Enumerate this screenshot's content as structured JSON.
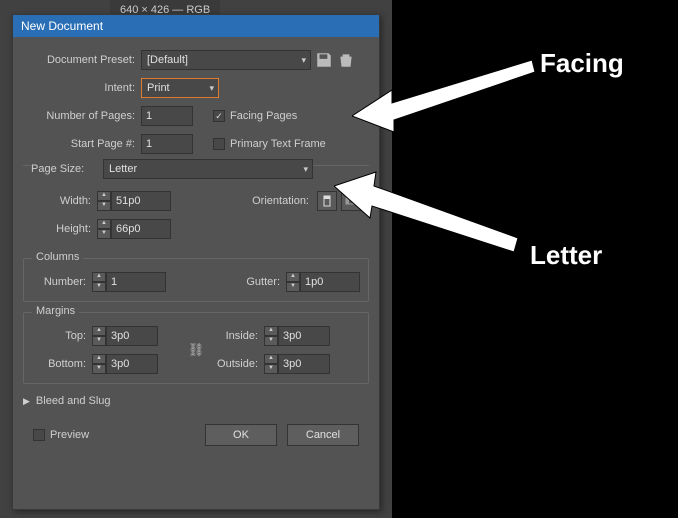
{
  "tab_scrap": "640 × 426 — RGB",
  "dialog": {
    "title": "New Document",
    "doc_preset_label": "Document Preset:",
    "doc_preset_value": "[Default]",
    "intent_label": "Intent:",
    "intent_value": "Print",
    "num_pages_label": "Number of Pages:",
    "num_pages_value": "1",
    "facing_pages_label": "Facing Pages",
    "facing_pages_checked": "✓",
    "start_page_label": "Start Page #:",
    "start_page_value": "1",
    "primary_tf_label": "Primary Text Frame",
    "page_size_label": "Page Size:",
    "page_size_value": "Letter",
    "width_label": "Width:",
    "width_value": "51p0",
    "height_label": "Height:",
    "height_value": "66p0",
    "orientation_label": "Orientation:",
    "columns_legend": "Columns",
    "col_number_label": "Number:",
    "col_number_value": "1",
    "gutter_label": "Gutter:",
    "gutter_value": "1p0",
    "margins_legend": "Margins",
    "m_top_label": "Top:",
    "m_top_value": "3p0",
    "m_bottom_label": "Bottom:",
    "m_bottom_value": "3p0",
    "m_inside_label": "Inside:",
    "m_inside_value": "3p0",
    "m_outside_label": "Outside:",
    "m_outside_value": "3p0",
    "bleed_slug_label": "Bleed and Slug",
    "preview_label": "Preview",
    "ok_label": "OK",
    "cancel_label": "Cancel"
  },
  "annotations": {
    "facing": "Facing",
    "letter": "Letter"
  }
}
